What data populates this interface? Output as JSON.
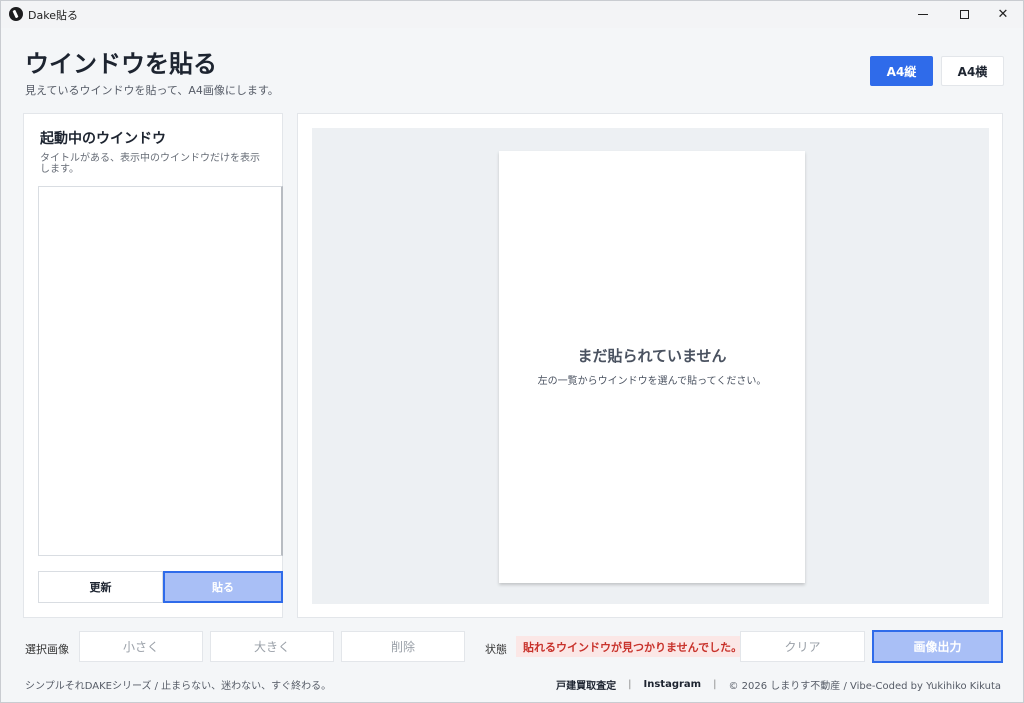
{
  "window": {
    "app_title": "Dake貼る"
  },
  "header": {
    "title": "ウインドウを貼る",
    "subtitle": "見えているウインドウを貼って、A4画像にします。",
    "orientation_buttons": {
      "portrait": "A4縦",
      "landscape": "A4横"
    },
    "selected_orientation": "portrait"
  },
  "left_panel": {
    "title": "起動中のウインドウ",
    "description": "タイトルがある、表示中のウインドウだけを表示します。",
    "window_list": [],
    "refresh_label": "更新",
    "paste_label": "貼る"
  },
  "preview": {
    "empty_title": "まだ貼られていません",
    "empty_description": "左の一覧からウインドウを選んで貼ってください。"
  },
  "toolbar": {
    "selected_image_label": "選択画像",
    "smaller_label": "小さく",
    "larger_label": "大きく",
    "delete_label": "削除",
    "status_label": "状態",
    "status_message": "貼れるウインドウが見つかりませんでした。",
    "clear_label": "クリア",
    "export_label": "画像出力"
  },
  "footer": {
    "tagline": "シンプルそれDAKEシリーズ / 止まらない、迷わない、すぐ終わる。",
    "link_1": "戸建買取査定",
    "link_2": "Instagram",
    "copyright": "© 2026 しまりす不動産 / Vibe-Coded by Yukihiko Kikuta",
    "separator": "|"
  },
  "colors": {
    "accent": "#2f6bea",
    "accent_disabled": "#a9bff6",
    "error_text": "#c8322b",
    "error_bg": "#fbe7e6"
  }
}
